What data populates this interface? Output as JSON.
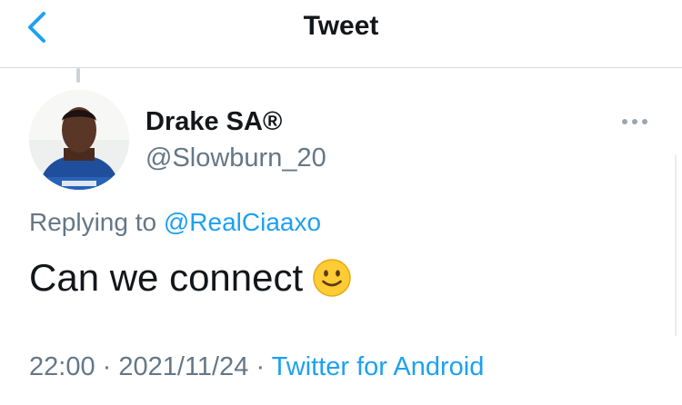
{
  "header": {
    "title": "Tweet"
  },
  "tweet": {
    "author_name": "Drake SA®",
    "author_handle": "@Slowburn_20",
    "replying_prefix": "Replying to",
    "replying_to": "@RealCiaaxo",
    "text": "Can we connect",
    "time": "22:00",
    "separator": "·",
    "date": "2021/11/24",
    "client": "Twitter for Android"
  },
  "colors": {
    "accent": "#1da1f2",
    "secondary_text": "#657786",
    "primary_text": "#14171a"
  },
  "icons": {
    "back": "chevron-left-icon",
    "more": "ellipsis-icon",
    "emoji": "smiling-face-emoji"
  }
}
